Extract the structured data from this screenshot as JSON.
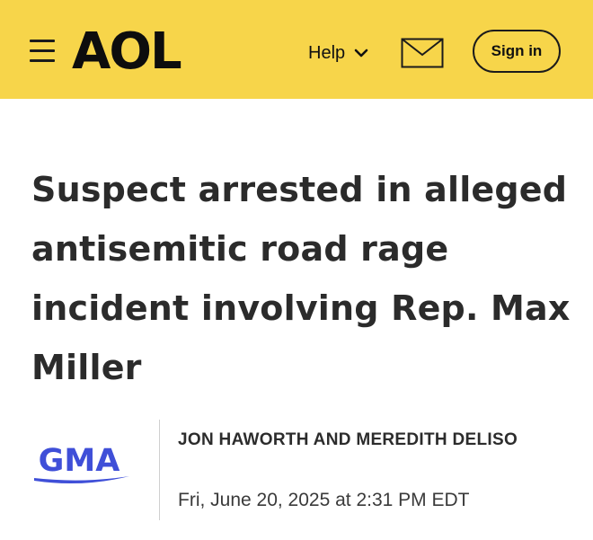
{
  "header": {
    "logo_text": "AOL",
    "help_label": "Help",
    "signin_label": "Sign in",
    "background_color": "#f7d54a",
    "icons": [
      "menu-icon",
      "chevron-down-icon",
      "mail-icon"
    ]
  },
  "article": {
    "headline": "Suspect arrested in alleged antisemitic road rage incident involving Rep. Max Miller",
    "source_logo_text": "GMA",
    "source_color": "#3f4fd8",
    "authors": "JON HAWORTH AND MEREDITH DELISO",
    "date": "Fri, June 20, 2025 at 2:31 PM EDT"
  }
}
